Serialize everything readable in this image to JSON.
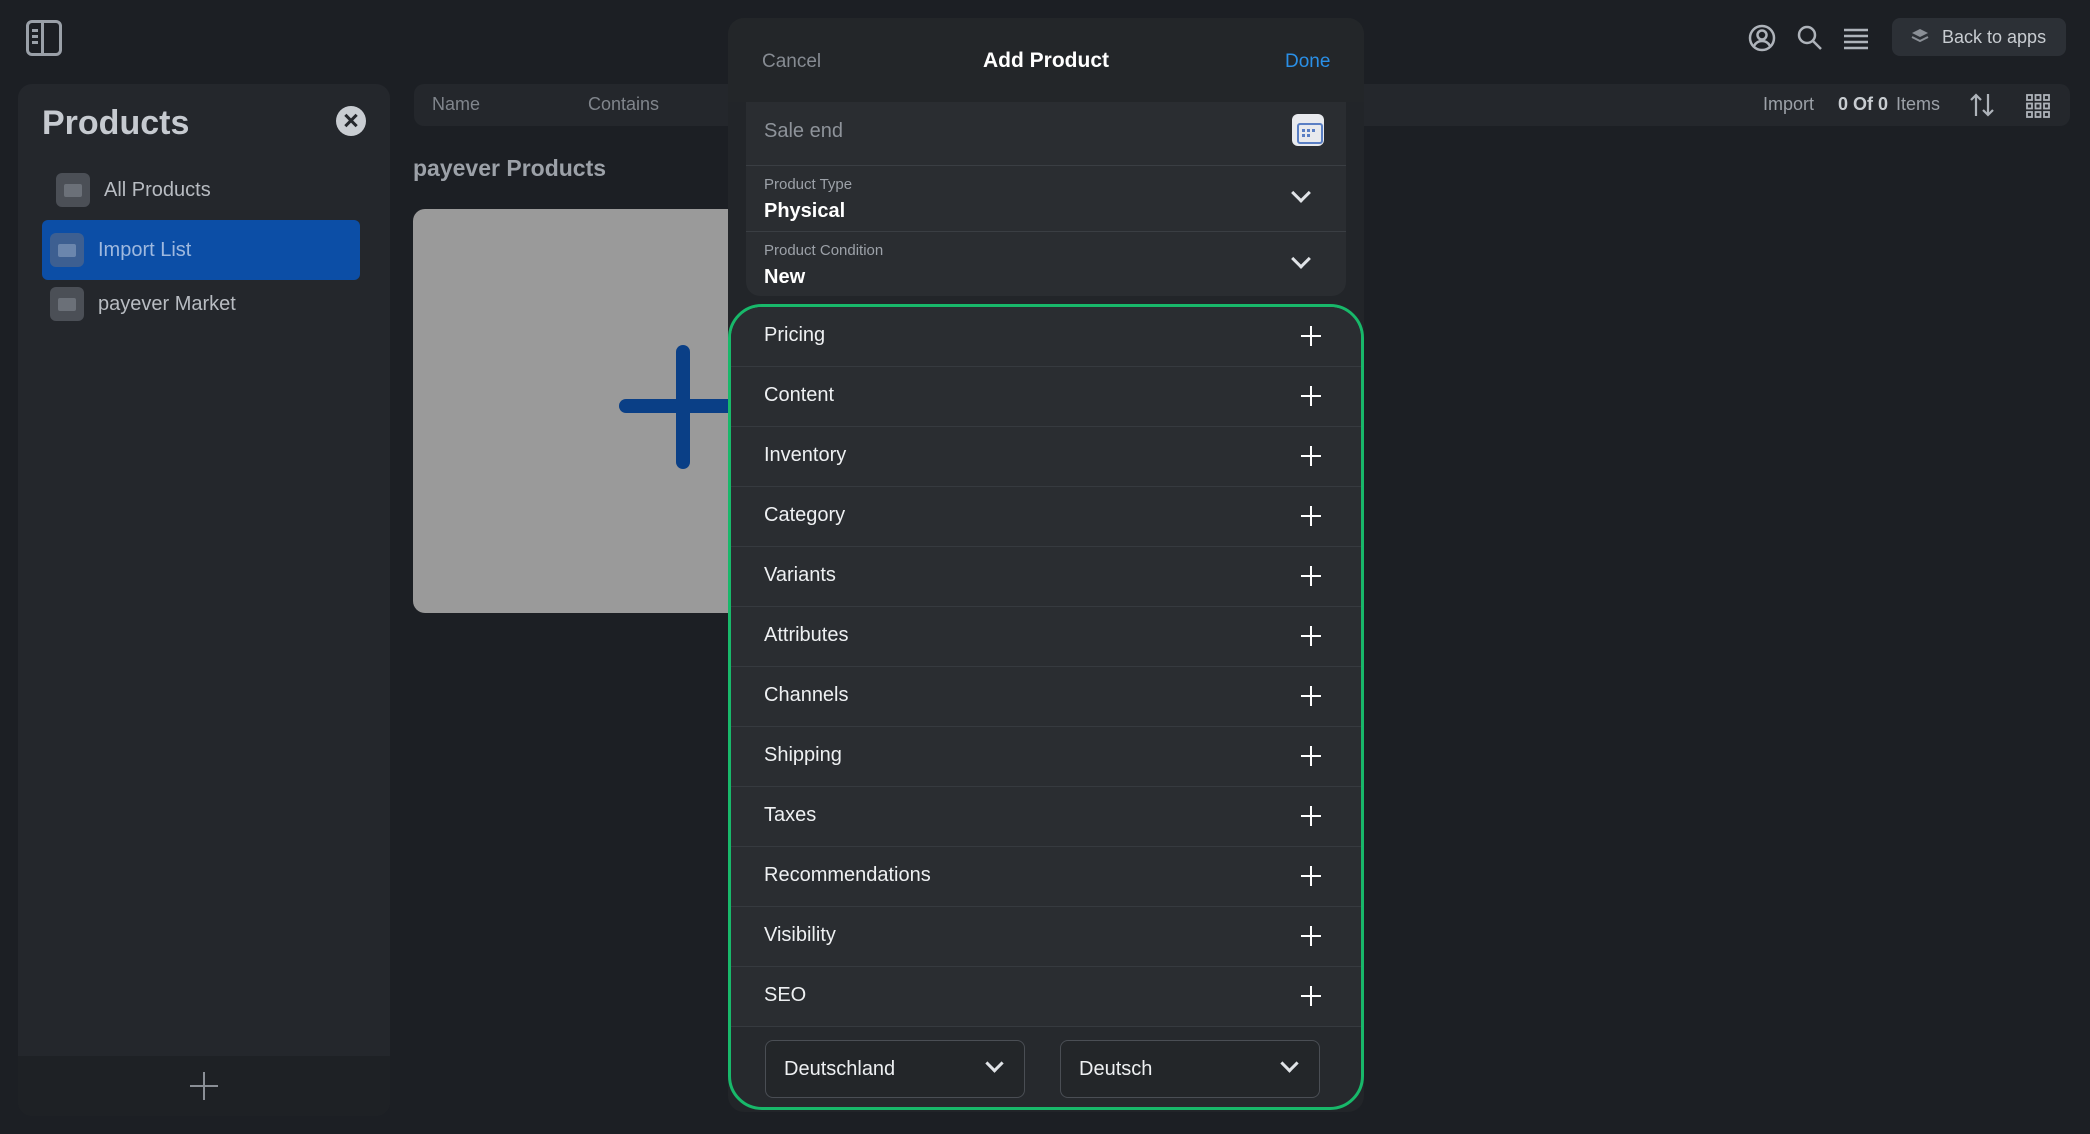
{
  "topbar": {
    "back_to_apps": "Back to apps",
    "icons": [
      "sidebar-toggle-icon",
      "account-icon",
      "search-icon",
      "menu-icon",
      "apps-stack-icon"
    ]
  },
  "sidebar": {
    "title": "Products",
    "items": [
      {
        "label": "All Products",
        "active": false
      },
      {
        "label": "Import List",
        "active": true
      },
      {
        "label": "payever Market",
        "active": false
      }
    ]
  },
  "filterbar": {
    "column_name": "Name",
    "condition": "Contains",
    "import_label": "Import",
    "count": "0 Of 0",
    "items_label": "Items"
  },
  "main": {
    "section_title": "payever Products"
  },
  "modal": {
    "cancel": "Cancel",
    "title": "Add Product",
    "done": "Done",
    "sale_end_placeholder": "Sale end",
    "product_type": {
      "label": "Product Type",
      "value": "Physical"
    },
    "product_condition": {
      "label": "Product Condition",
      "value": "New"
    },
    "sections": [
      "Pricing",
      "Content",
      "Inventory",
      "Category",
      "Variants",
      "Attributes",
      "Channels",
      "Shipping",
      "Taxes",
      "Recommendations",
      "Visibility",
      "SEO"
    ],
    "country_select": "Deutschland",
    "language_select": "Deutsch"
  },
  "colors": {
    "accent_blue": "#2a8fe6",
    "active_item": "#0c4ea6",
    "section_outline": "#18b86a"
  }
}
